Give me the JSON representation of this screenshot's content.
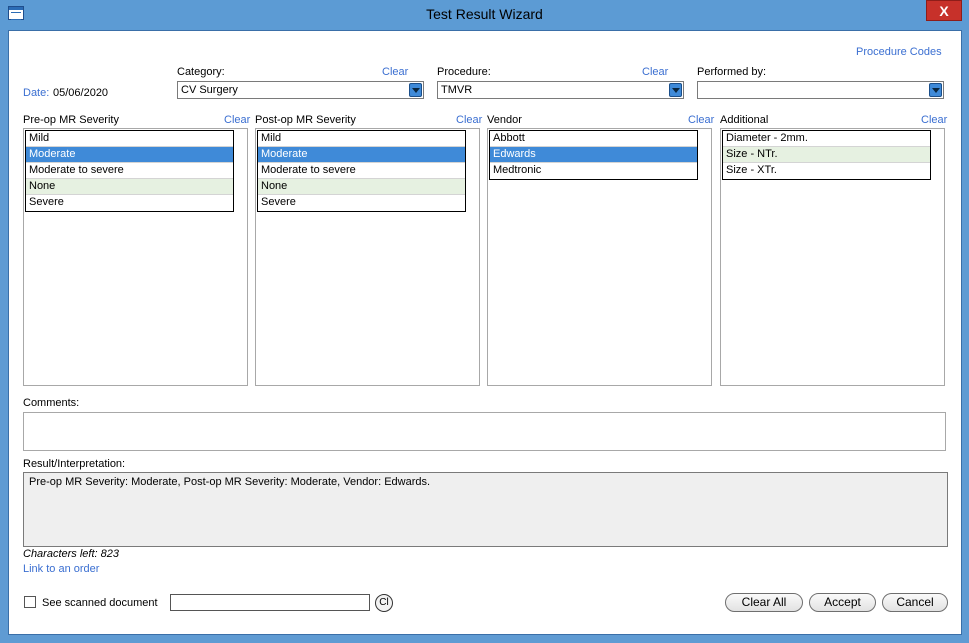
{
  "window": {
    "title": "Test Result Wizard",
    "close_label": "X"
  },
  "procedure_codes_link": "Procedure Codes",
  "date": {
    "label": "Date:",
    "value": "05/06/2020"
  },
  "category": {
    "label": "Category:",
    "clear": "Clear",
    "value": "CV Surgery"
  },
  "procedure": {
    "label": "Procedure:",
    "clear": "Clear",
    "value": "TMVR"
  },
  "performed_by": {
    "label": "Performed by:",
    "value": ""
  },
  "lists": [
    {
      "label": "Pre-op MR Severity",
      "clear": "Clear",
      "items": [
        "Mild",
        "Moderate",
        "Moderate to severe",
        "None",
        "Severe"
      ]
    },
    {
      "label": "Post-op MR Severity",
      "clear": "Clear",
      "items": [
        "Mild",
        "Moderate",
        "Moderate to severe",
        "None",
        "Severe"
      ]
    },
    {
      "label": "Vendor",
      "clear": "Clear",
      "items": [
        "Abbott",
        "Edwards",
        "Medtronic"
      ]
    },
    {
      "label": "Additional",
      "clear": "Clear",
      "items": [
        "Diameter - 2mm.",
        "Size - NTr.",
        "Size - XTr."
      ]
    }
  ],
  "comments": {
    "label": "Comments:",
    "value": ""
  },
  "result": {
    "label": "Result/Interpretation:",
    "value": "Pre-op MR Severity: Moderate, Post-op MR Severity: Moderate, Vendor: Edwards."
  },
  "characters_left": "Characters left: 823",
  "link_to_order": "Link to an order",
  "scanned": {
    "label": "See scanned document",
    "value": "",
    "button": "Cl"
  },
  "buttons": {
    "clear_all": "Clear All",
    "accept": "Accept",
    "cancel": "Cancel"
  }
}
